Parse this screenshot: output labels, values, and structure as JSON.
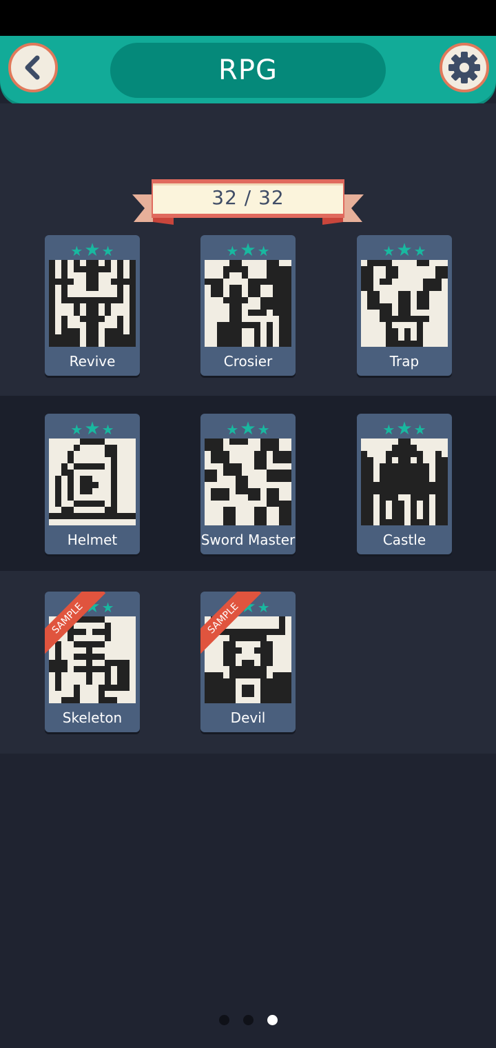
{
  "header": {
    "title": "RPG"
  },
  "icons": {
    "back": "chevron-left-icon",
    "settings": "gear-icon"
  },
  "progress": {
    "text": "32 / 32",
    "solved": 32,
    "total": 32
  },
  "colors": {
    "accent": "#12ab98",
    "star": "#19b8a0",
    "sample": "#e0543e",
    "card": "#4a5f7d"
  },
  "puzzles": [
    {
      "name": "Revive",
      "stars": 3,
      "sample": false
    },
    {
      "name": "Crosier",
      "stars": 3,
      "sample": false
    },
    {
      "name": "Trap",
      "stars": 3,
      "sample": false
    },
    {
      "name": "Helmet",
      "stars": 3,
      "sample": false
    },
    {
      "name": "Sword Master",
      "stars": 3,
      "sample": false
    },
    {
      "name": "Castle",
      "stars": 3,
      "sample": false
    },
    {
      "name": "Skeleton",
      "stars": 3,
      "sample": true,
      "badge": "SAMPLE"
    },
    {
      "name": "Devil",
      "stars": 3,
      "sample": true,
      "badge": "SAMPLE"
    }
  ],
  "pager": {
    "pages": 3,
    "current": 3
  }
}
